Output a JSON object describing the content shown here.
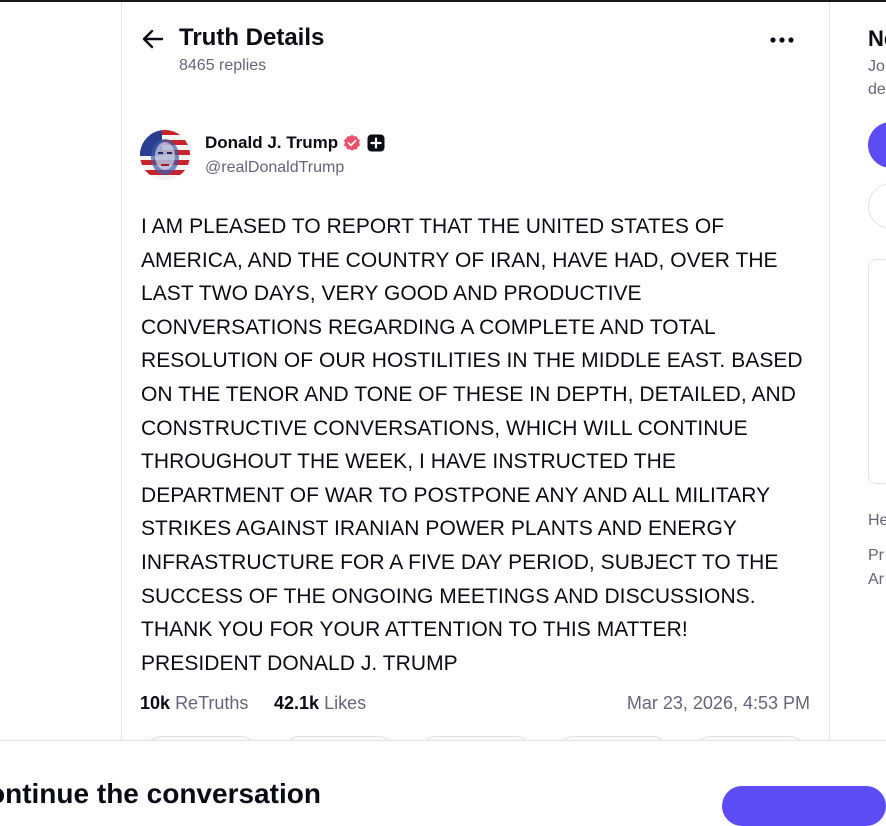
{
  "header": {
    "title": "Truth Details",
    "replies": "8465 replies"
  },
  "author": {
    "name": "Donald J. Trump",
    "handle": "@realDonaldTrump"
  },
  "post": {
    "lines": [
      "I AM PLEASED TO REPORT THAT THE UNITED STATES OF",
      "AMERICA, AND THE COUNTRY OF IRAN, HAVE HAD, OVER THE",
      "LAST TWO DAYS, VERY GOOD AND PRODUCTIVE",
      "CONVERSATIONS REGARDING A COMPLETE AND TOTAL",
      "RESOLUTION OF OUR HOSTILITIES IN THE MIDDLE EAST. BASED",
      "ON THE TENOR AND TONE OF THESE IN DEPTH, DETAILED, AND",
      "CONSTRUCTIVE CONVERSATIONS, WHICH WILL CONTINUE",
      "THROUGHOUT THE WEEK, I HAVE INSTRUCTED THE",
      "DEPARTMENT OF WAR TO POSTPONE ANY AND ALL MILITARY",
      "STRIKES AGAINST IRANIAN POWER PLANTS AND ENERGY",
      "INFRASTRUCTURE FOR A FIVE DAY PERIOD, SUBJECT TO THE",
      "SUCCESS OF THE ONGOING MEETINGS AND DISCUSSIONS.",
      "THANK YOU FOR YOUR ATTENTION TO THIS MATTER!",
      "PRESIDENT DONALD J. TRUMP"
    ]
  },
  "stats": {
    "retruths_count": "10k",
    "retruths_label": "ReTruths",
    "likes_count": "42.1k",
    "likes_label": "Likes",
    "timestamp": "Mar 23, 2026, 4:53 PM"
  },
  "bottom": {
    "continue_text": "ontinue the conversation"
  },
  "sidebar_fragments": {
    "title": "Ne",
    "line1": "Jo",
    "line2": "de",
    "line3": "He",
    "line4": "Pr",
    "line5": "Ar"
  },
  "colors": {
    "accent": "#5b4cf5",
    "verified": "#f04d6b",
    "muted_text": "#656578"
  },
  "icons": [
    "back-arrow-icon",
    "more-options-icon",
    "verified-badge-icon",
    "plus-badge-icon"
  ]
}
